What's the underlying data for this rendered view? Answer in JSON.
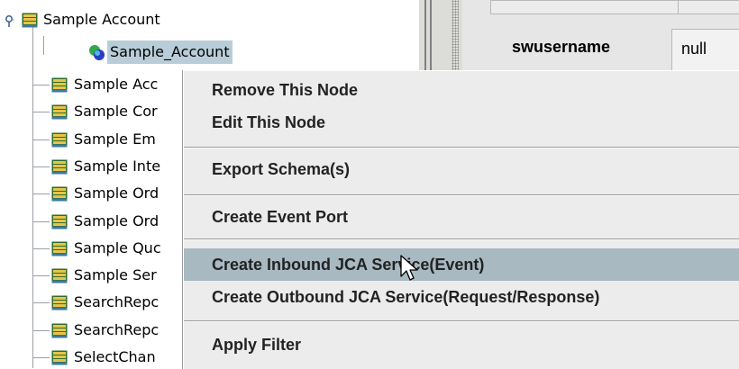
{
  "tree": {
    "root": {
      "label": "Sample Account",
      "icon": "folder-table-icon",
      "expanded": true
    },
    "child": {
      "label": "Sample_Account",
      "icon": "business-object-icon",
      "selected": true
    },
    "items": [
      {
        "label": "Sample Acc"
      },
      {
        "label": "Sample Cor"
      },
      {
        "label": "Sample Em"
      },
      {
        "label": "Sample Inte"
      },
      {
        "label": "Sample Ord"
      },
      {
        "label": "Sample Ord"
      },
      {
        "label": "Sample Quc"
      },
      {
        "label": "Sample Ser"
      },
      {
        "label": "SearchRepc"
      },
      {
        "label": "SearchRepc"
      },
      {
        "label": "SelectChan"
      }
    ]
  },
  "properties": {
    "key": "swusername",
    "value": "null"
  },
  "context_menu": {
    "items": [
      {
        "label": "Remove This Node"
      },
      {
        "label": "Edit This Node"
      },
      {
        "label": "Export Schema(s)"
      },
      {
        "label": "Create Event Port"
      },
      {
        "label": "Create Inbound JCA Service(Event)",
        "hovered": true
      },
      {
        "label": "Create Outbound JCA Service(Request/Response)"
      },
      {
        "label": "Apply Filter"
      }
    ]
  },
  "colors": {
    "selection": "#b9cdd8",
    "menu_hover": "#a8b9c2",
    "menu_bg": "#ececec"
  }
}
